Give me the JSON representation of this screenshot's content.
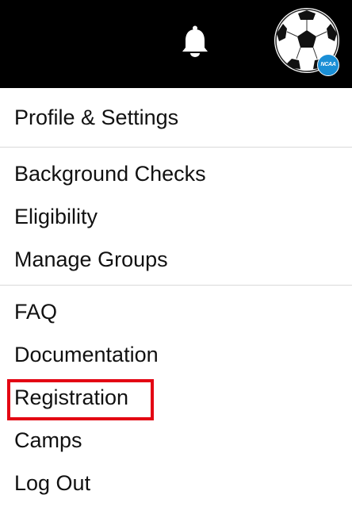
{
  "header": {
    "notifications_icon": "bell-icon",
    "avatar_icon": "soccer-ball-icon",
    "avatar_badge": "NCAA",
    "colors": {
      "background": "#000000",
      "badge": "#1a8fd6"
    }
  },
  "menu": {
    "groups": [
      {
        "items": [
          {
            "label": "Profile & Settings"
          }
        ]
      },
      {
        "items": [
          {
            "label": "Background Checks"
          },
          {
            "label": "Eligibility"
          },
          {
            "label": "Manage Groups"
          }
        ]
      },
      {
        "items": [
          {
            "label": "FAQ"
          },
          {
            "label": "Documentation"
          },
          {
            "label": "Registration",
            "highlighted": true
          },
          {
            "label": "Camps"
          },
          {
            "label": "Log Out"
          }
        ]
      }
    ],
    "highlight_color": "#e30613"
  }
}
